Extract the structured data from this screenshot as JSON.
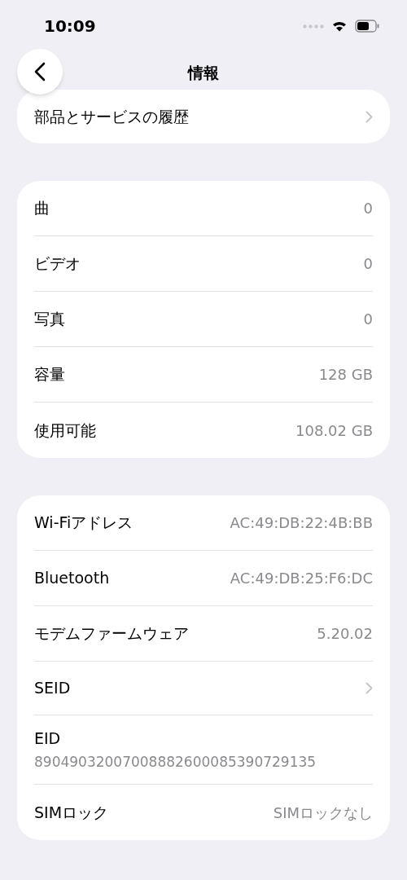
{
  "status_bar": {
    "time": "10:09"
  },
  "nav": {
    "title": "情報"
  },
  "sections": [
    {
      "rows": [
        {
          "kind": "link",
          "label": "部品とサービスの履歴"
        }
      ]
    },
    {
      "rows": [
        {
          "kind": "value",
          "label": "曲",
          "value": "0"
        },
        {
          "kind": "value",
          "label": "ビデオ",
          "value": "0"
        },
        {
          "kind": "value",
          "label": "写真",
          "value": "0"
        },
        {
          "kind": "value",
          "label": "容量",
          "value": "128 GB"
        },
        {
          "kind": "value",
          "label": "使用可能",
          "value": "108.02 GB"
        }
      ]
    },
    {
      "rows": [
        {
          "kind": "value",
          "label": "Wi-Fiアドレス",
          "value": "AC:49:DB:22:4B:BB"
        },
        {
          "kind": "value",
          "label": "Bluetooth",
          "value": "AC:49:DB:25:F6:DC"
        },
        {
          "kind": "value",
          "label": "モデムファームウェア",
          "value": "5.20.02"
        },
        {
          "kind": "link",
          "label": "SEID"
        },
        {
          "kind": "stacked",
          "label": "EID",
          "value": "89049032007008882600085390729135"
        },
        {
          "kind": "value",
          "label": "SIMロック",
          "value": "SIMロックなし"
        }
      ]
    }
  ]
}
